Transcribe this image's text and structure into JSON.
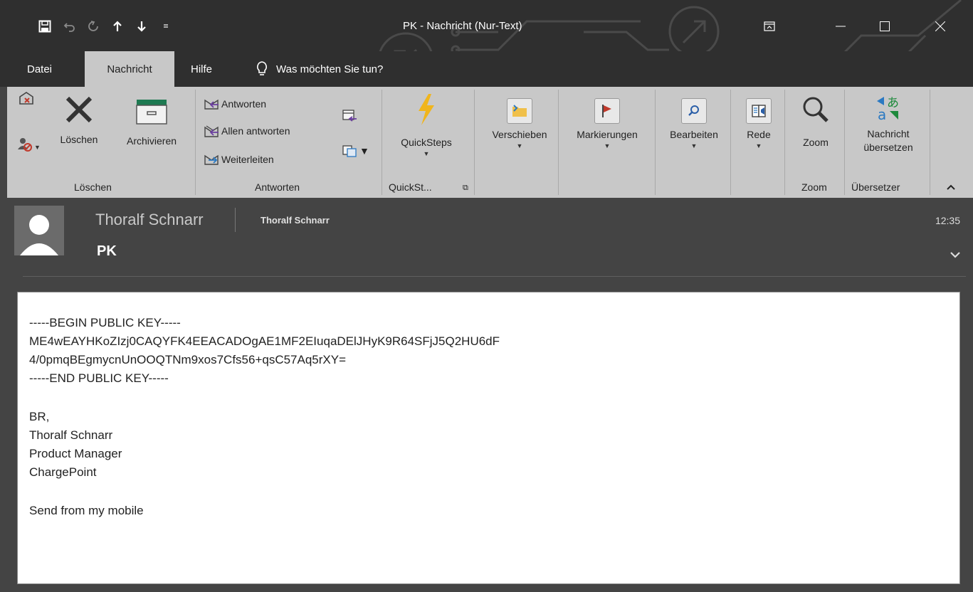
{
  "window": {
    "title": "PK  -  Nachricht (Nur-Text)"
  },
  "quick_access": {
    "icons": [
      "save-icon",
      "undo-icon",
      "redo-icon",
      "previous-item-icon",
      "next-item-icon",
      "customize-qat-icon"
    ]
  },
  "tabs": [
    {
      "label": "Datei"
    },
    {
      "label": "Nachricht"
    },
    {
      "label": "Hilfe"
    },
    {
      "label": "Was möchten Sie tun?"
    }
  ],
  "ribbon": {
    "loeschen": {
      "delete_label": "Löschen",
      "archive_label": "Archivieren",
      "group_label": "Löschen"
    },
    "antworten": {
      "reply_label": "Antworten",
      "reply_all_label": "Allen antworten",
      "forward_label": "Weiterleiten",
      "group_label": "Antworten"
    },
    "quicksteps": {
      "label": "QuickSteps",
      "group_label": "QuickSt..."
    },
    "verschieben_label": "Verschieben",
    "markierungen_label": "Markierungen",
    "bearbeiten_label": "Bearbeiten",
    "rede_label": "Rede",
    "zoom": {
      "label": "Zoom",
      "group_label": "Zoom"
    },
    "translate": {
      "label_line1": "Nachricht",
      "label_line2": "übersetzen",
      "group_label": "Übersetzer"
    }
  },
  "message": {
    "sender": "Thoralf Schnarr",
    "recipient": "Thoralf Schnarr",
    "subject": "PK",
    "time": "12:35",
    "body_lines": [
      "-----BEGIN PUBLIC KEY-----",
      "ME4wEAYHKoZIzj0CAQYFK4EEACADOgAE1MF2EIuqaDElJHyK9R64SFjJ5Q2HU6dF",
      "4/0pmqBEgmycnUnOOQTNm9xos7Cfs56+qsC57Aq5rXY=",
      "-----END PUBLIC KEY-----",
      "",
      "BR,",
      "Thoralf Schnarr",
      "Product Manager",
      "ChargePoint",
      "",
      "Send from my mobile"
    ]
  },
  "colors": {
    "titlebar": "#2f2f2f",
    "ribbon": "#c8c8c8",
    "header": "#444444",
    "body": "#ffffff",
    "accent_blue": "#2b79c2",
    "accent_red": "#c0392b",
    "accent_green": "#1e8a3c"
  }
}
